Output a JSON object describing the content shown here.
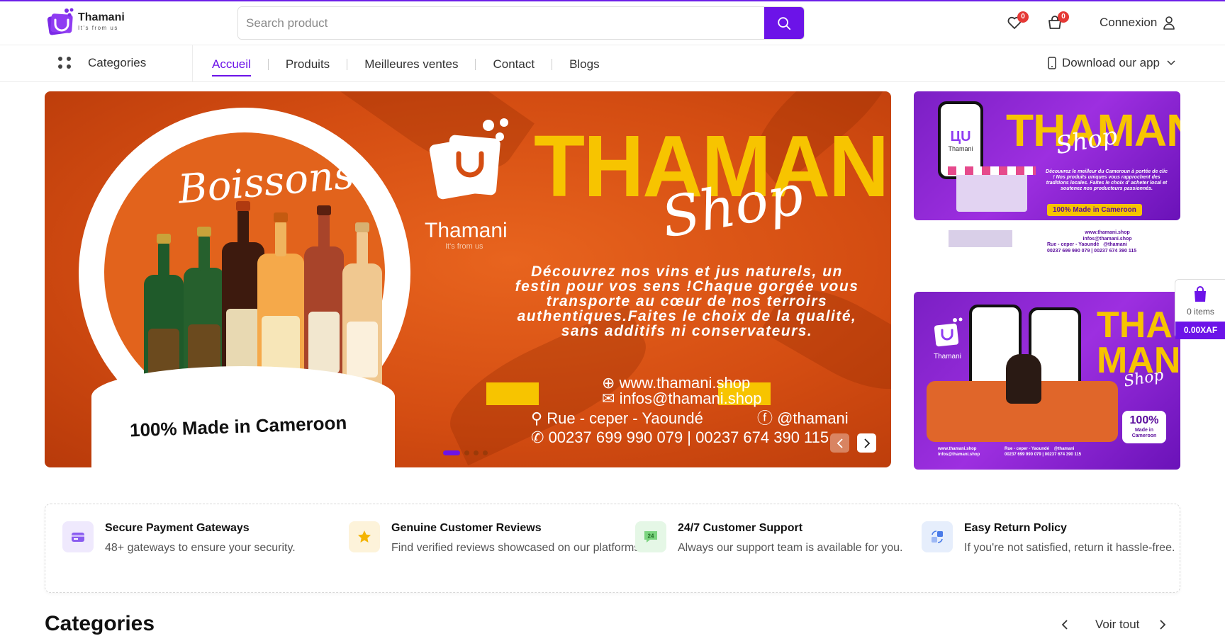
{
  "brand": {
    "name": "Thamani",
    "tagline": "It's from us",
    "accent": "#6c13e8"
  },
  "search": {
    "placeholder": "Search product",
    "icon": "search-icon"
  },
  "header": {
    "wishlist_count": "0",
    "cart_count": "0",
    "login_label": "Connexion"
  },
  "nav": {
    "categories_label": "Categories",
    "links": [
      {
        "label": "Accueil",
        "active": true
      },
      {
        "label": "Produits"
      },
      {
        "label": "Meilleures ventes"
      },
      {
        "label": "Contact"
      },
      {
        "label": "Blogs"
      }
    ],
    "download_label": "Download our app"
  },
  "hero": {
    "script_title": "Boissons",
    "made_in": "100% Made in Cameroon",
    "logo_name": "Thamani",
    "logo_tagline": "It's from us",
    "brand_title": "THAMANI",
    "brand_script": "Shop",
    "description": "Découvrez nos vins et jus naturels, un festin pour vos sens !Chaque gorgée vous transporte au cœur de nos terroirs authentiques.Faites le choix de la qualité, sans additifs ni conservateurs.",
    "website": "www.thamani.shop",
    "email": "infos@thamani.shop",
    "address": "Rue - ceper - Yaoundé",
    "social": "@thamani",
    "phones": "00237 699 990 079 | 00237 674 390 115",
    "slide_count": 4,
    "active_slide": 1
  },
  "side_banners": [
    {
      "title": "THAMANI",
      "script": "Shop",
      "phone_label": "Thamani",
      "text": "Découvrez le meilleur du Cameroun à portée de clic ! Nos produits uniques vous rapprochent des traditions locales. Faites le choix d' acheter local et soutenez nos producteurs passionnés.",
      "pill": "100% Made in Cameroon",
      "website": "www.thamani.shop",
      "email": "infos@thamani.shop",
      "address": "Rue - ceper - Yaoundé",
      "social": "@thamani",
      "phones": "00237 699 990 079 | 00237 674 390 115"
    },
    {
      "title_top": "THA",
      "title_bottom": "MANI",
      "script": "Shop",
      "logo_name": "Thamani",
      "badge_big": "100%",
      "badge_small": "Made in Cameroon",
      "website": "www.thamani.shop",
      "email": "infos@thamani.shop",
      "address": "Rue - ceper - Yaoundé",
      "social": "@thamani",
      "phones": "00237 699 990 079 | 00237 674 390 115"
    }
  ],
  "floating_cart": {
    "items": "0 items",
    "total": "0.00XAF"
  },
  "features": [
    {
      "title": "Secure Payment Gateways",
      "desc": "48+ gateways to ensure your security.",
      "icon": "payment-card-icon",
      "bg": "#efe9fd"
    },
    {
      "title": "Genuine Customer Reviews",
      "desc": "Find verified reviews showcased on our platforms.",
      "icon": "star-icon",
      "bg": "#fdf3da"
    },
    {
      "title": "24/7 Customer Support",
      "desc": "Always our support team is available for you.",
      "icon": "support-24-icon",
      "bg": "#e5f7e6"
    },
    {
      "title": "Easy Return Policy",
      "desc": "If you're not satisfied, return it hassle-free.",
      "icon": "return-box-icon",
      "bg": "#e6eefc"
    }
  ],
  "categories": {
    "title": "Categories",
    "see_all": "Voir tout"
  }
}
